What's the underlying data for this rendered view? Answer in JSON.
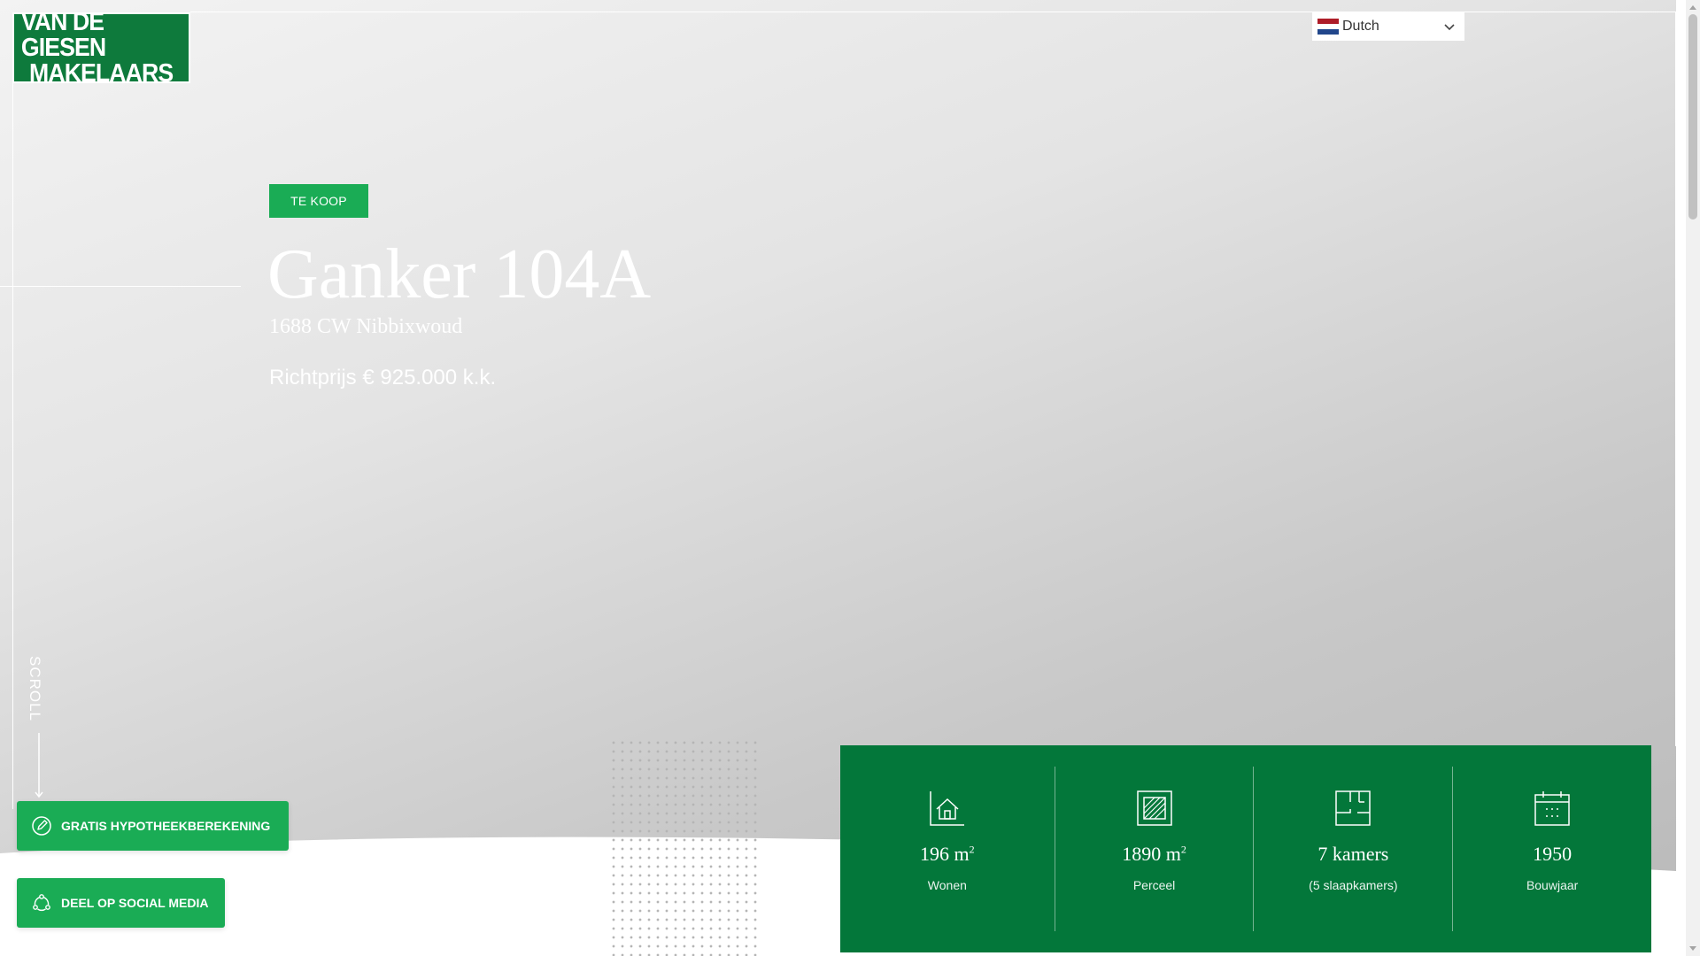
{
  "logo": {
    "line1": "VAN DE GIESEN",
    "line2": "MAKELAARS"
  },
  "language_selector": {
    "selected": "Dutch",
    "flag_colors": [
      "#ae1c28",
      "#ffffff",
      "#21468b"
    ]
  },
  "listing": {
    "status": "TE KOOP",
    "title": "Ganker 104A",
    "address": "1688 CW Nibbixwoud",
    "price": "Richtprijs € 925.000 k.k."
  },
  "scroll": {
    "label": "SCROLL"
  },
  "cta": {
    "mortgage_label": "GRATIS HYPOTHEEKBEREKENING",
    "share_label": "DEEL OP SOCIAL MEDIA"
  },
  "features": [
    {
      "icon": "house-area-icon",
      "value": "196 m",
      "sup": "2",
      "caption": "Wonen"
    },
    {
      "icon": "plot-area-icon",
      "value": "1890 m",
      "sup": "2",
      "caption": "Perceel"
    },
    {
      "icon": "floorplan-icon",
      "value": "7 kamers",
      "sup": "",
      "caption": "(5 slaapkamers)"
    },
    {
      "icon": "calendar-icon",
      "value": "1950",
      "sup": "",
      "caption": "Bouwjaar"
    }
  ],
  "colors": {
    "brand_green": "#1aac55",
    "dark_green": "#03773a",
    "logo_green": "#0e7a3c"
  }
}
